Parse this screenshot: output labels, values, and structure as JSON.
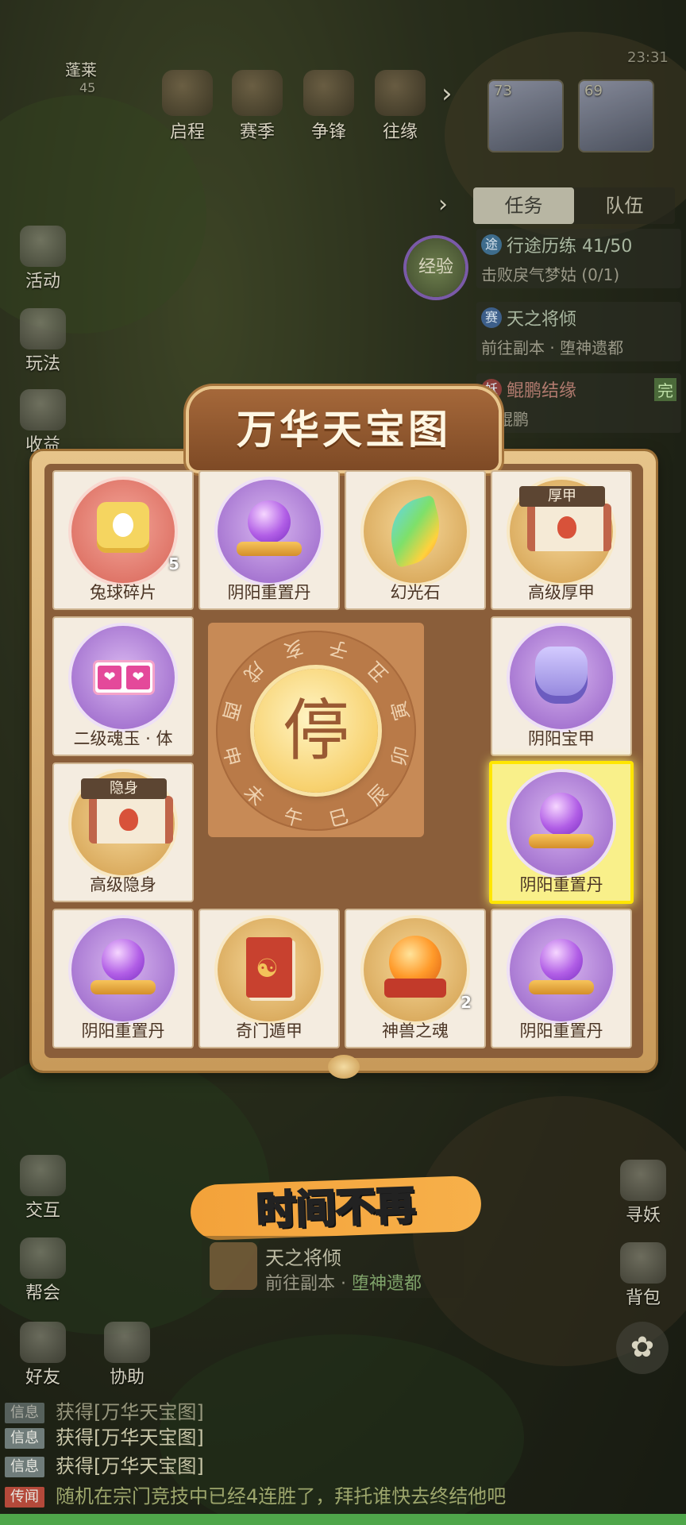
{
  "location": {
    "name": "蓬莱",
    "coords": "45"
  },
  "status": {
    "time": "23:31"
  },
  "top_menu": [
    {
      "label": "启程",
      "icon": "journey-icon"
    },
    {
      "label": "赛季",
      "icon": "season-icon"
    },
    {
      "label": "争锋",
      "icon": "battle-icon"
    },
    {
      "label": "往缘",
      "icon": "fate-icon"
    }
  ],
  "team_levels": [
    "73",
    "69"
  ],
  "left_menu": [
    {
      "label": "活动",
      "icon": "activity-icon"
    },
    {
      "label": "玩法",
      "icon": "gameplay-icon"
    },
    {
      "label": "收益",
      "icon": "income-icon"
    }
  ],
  "exp_badge": "经验",
  "task_panel": {
    "tabs": [
      "任务",
      "队伍"
    ],
    "tasks": [
      {
        "tag": "途",
        "title": "行途历练 41/50",
        "desc": "击败戾气梦姑 (0/1)"
      },
      {
        "tag": "赛",
        "title": "天之将倾",
        "desc": "前往副本 · 堕神遗都"
      },
      {
        "tag": "妖",
        "title": "鲲鹏结缘",
        "desc": "寻鲲鹏",
        "done": "完"
      }
    ]
  },
  "board": {
    "title": "万华天宝图",
    "stop_label": "停",
    "zodiac": [
      "子",
      "丑",
      "寅",
      "卯",
      "辰",
      "巳",
      "午",
      "未",
      "申",
      "酉",
      "戌",
      "亥"
    ],
    "cells": [
      {
        "name": "兔球碎片",
        "count": "5",
        "icon": "puzzle-piece-icon",
        "bg": "red"
      },
      {
        "name": "阴阳重置丹",
        "icon": "purple-orb-icon",
        "bg": "purple"
      },
      {
        "name": "幻光石",
        "icon": "rainbow-stone-icon",
        "bg": "gold"
      },
      {
        "name": "高级厚甲",
        "ribbon": "厚甲",
        "icon": "scroll-icon",
        "bg": "gold"
      },
      {
        "name": "阴阳宝甲",
        "icon": "armor-icon",
        "bg": "purple"
      },
      {
        "name": "阴阳重置丹",
        "icon": "purple-orb-icon",
        "bg": "purple",
        "highlighted": true
      },
      {
        "name": "阴阳重置丹",
        "icon": "purple-orb-icon",
        "bg": "purple"
      },
      {
        "name": "神兽之魂",
        "count": "2",
        "icon": "beast-soul-icon",
        "bg": "gold"
      },
      {
        "name": "奇门遁甲",
        "icon": "book-icon",
        "bg": "gold"
      },
      {
        "name": "阴阳重置丹",
        "icon": "purple-orb-icon",
        "bg": "purple"
      },
      {
        "name": "高级隐身",
        "ribbon": "隐身",
        "icon": "scroll-icon",
        "bg": "gold"
      },
      {
        "name": "二级魂玉 · 体",
        "icon": "soul-jade-icon",
        "bg": "purple"
      }
    ]
  },
  "banner": "时间不再",
  "hint": {
    "title": "天之将倾",
    "desc_prefix": "前往副本 · ",
    "desc_place": "堕神遗都"
  },
  "lower_left_menu": [
    {
      "label": "交互",
      "icon": "interact-icon"
    },
    {
      "label": "帮会",
      "icon": "guild-icon"
    },
    {
      "label": "好友",
      "icon": "friends-icon"
    },
    {
      "label": "协助",
      "icon": "assist-icon"
    }
  ],
  "right_menu": [
    {
      "label": "寻妖",
      "icon": "seek-demon-icon"
    },
    {
      "label": "背包",
      "icon": "bag-icon"
    }
  ],
  "chat": [
    {
      "tag": "信息",
      "text": "获得[万华天宝图]"
    },
    {
      "tag": "信息",
      "text": "获得[万华天宝图]"
    },
    {
      "tag": "信息",
      "text": "获得[万华天宝图]"
    },
    {
      "tag": "传闻",
      "text": "随机在宗门竞技中已经4连胜了，拜托谁快去终结他吧"
    }
  ]
}
